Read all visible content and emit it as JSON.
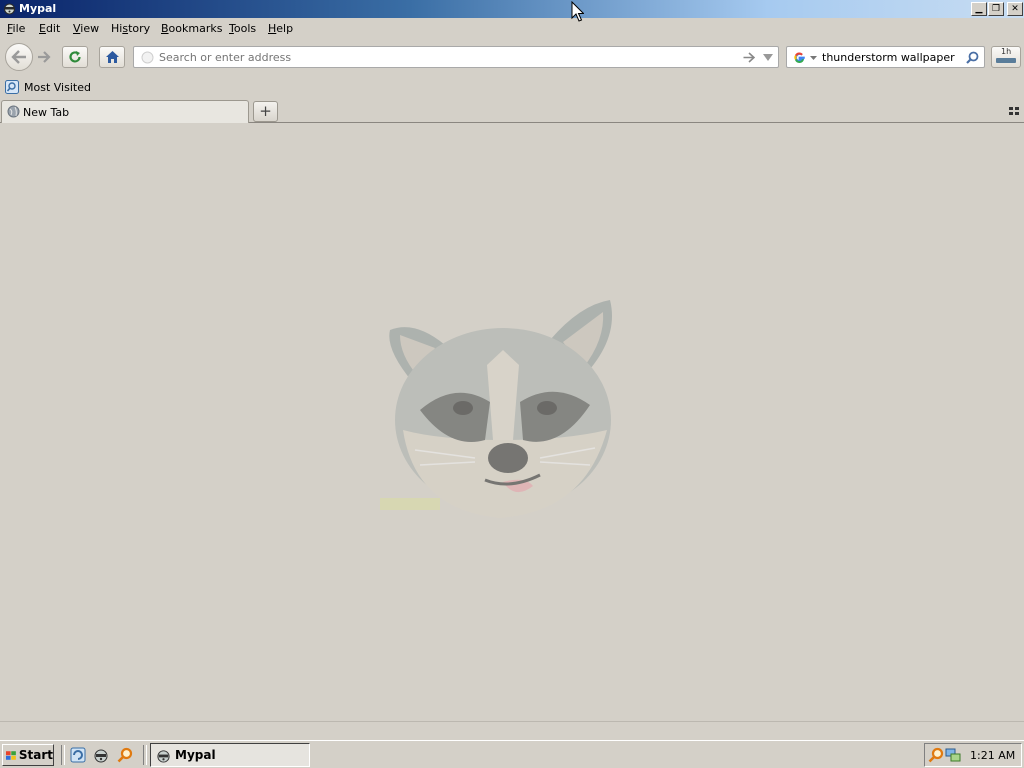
{
  "window": {
    "title": "Mypal",
    "controls": [
      "minimize-icon",
      "restore-icon",
      "close-icon"
    ]
  },
  "menubar": {
    "items": [
      "File",
      "Edit",
      "View",
      "History",
      "Bookmarks",
      "Tools",
      "Help"
    ],
    "accelerators": [
      "F",
      "E",
      "V",
      "s",
      "B",
      "T",
      "H"
    ]
  },
  "toolbar": {
    "back_icon": "back-arrow-icon",
    "forward_icon": "forward-arrow-icon",
    "reload_icon": "reload-icon",
    "home_icon": "home-icon",
    "url_placeholder": "Search or enter address",
    "url_value": "",
    "search_engine_icon": "google-icon",
    "search_value": "thunderstorm wallpaper",
    "addon_icon_text": "1h"
  },
  "bookmarks": {
    "items": [
      {
        "label": "Most Visited",
        "icon": "bookmark-folder-icon"
      }
    ]
  },
  "tabs": {
    "items": [
      {
        "label": "New Tab",
        "icon": "globe-icon",
        "selected": true
      }
    ],
    "new_tab_label": "+",
    "tab_list_icon": "grid-icon"
  },
  "content": {
    "logo": "raccoon-face-logo"
  },
  "taskbar": {
    "start_label": "Start",
    "quick_launch": [
      "browser-icon",
      "raccoon-icon",
      "search-icon"
    ],
    "tasks": [
      {
        "label": "Mypal",
        "icon": "raccoon-icon",
        "active": true
      }
    ],
    "tray_icons": [
      "search-icon",
      "network-icon"
    ],
    "clock": "1:21 AM"
  },
  "colors": {
    "titlebar_start": "#0a246a",
    "titlebar_end": "#c8ddf2",
    "chrome": "#d4d0c8"
  }
}
